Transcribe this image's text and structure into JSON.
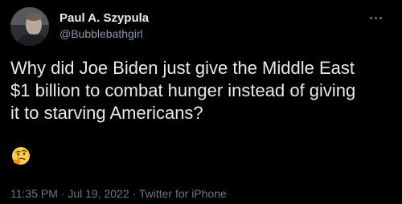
{
  "author": {
    "display_name": "Paul A. Szypula",
    "handle": "@Bubblebathgirl"
  },
  "tweet": {
    "line1": "Why did Joe Biden just give the Middle East",
    "line2": "$1 billion to combat hunger instead of giving",
    "line3": "it to starving Americans?",
    "emoji": "thinking-face"
  },
  "meta": {
    "time": "11:35 PM",
    "date": "Jul 19, 2022",
    "client": "Twitter for iPhone",
    "separator": "·"
  },
  "colors": {
    "background": "#000000",
    "primary_text": "#e7e9ea",
    "secondary_text": "#71767b"
  }
}
